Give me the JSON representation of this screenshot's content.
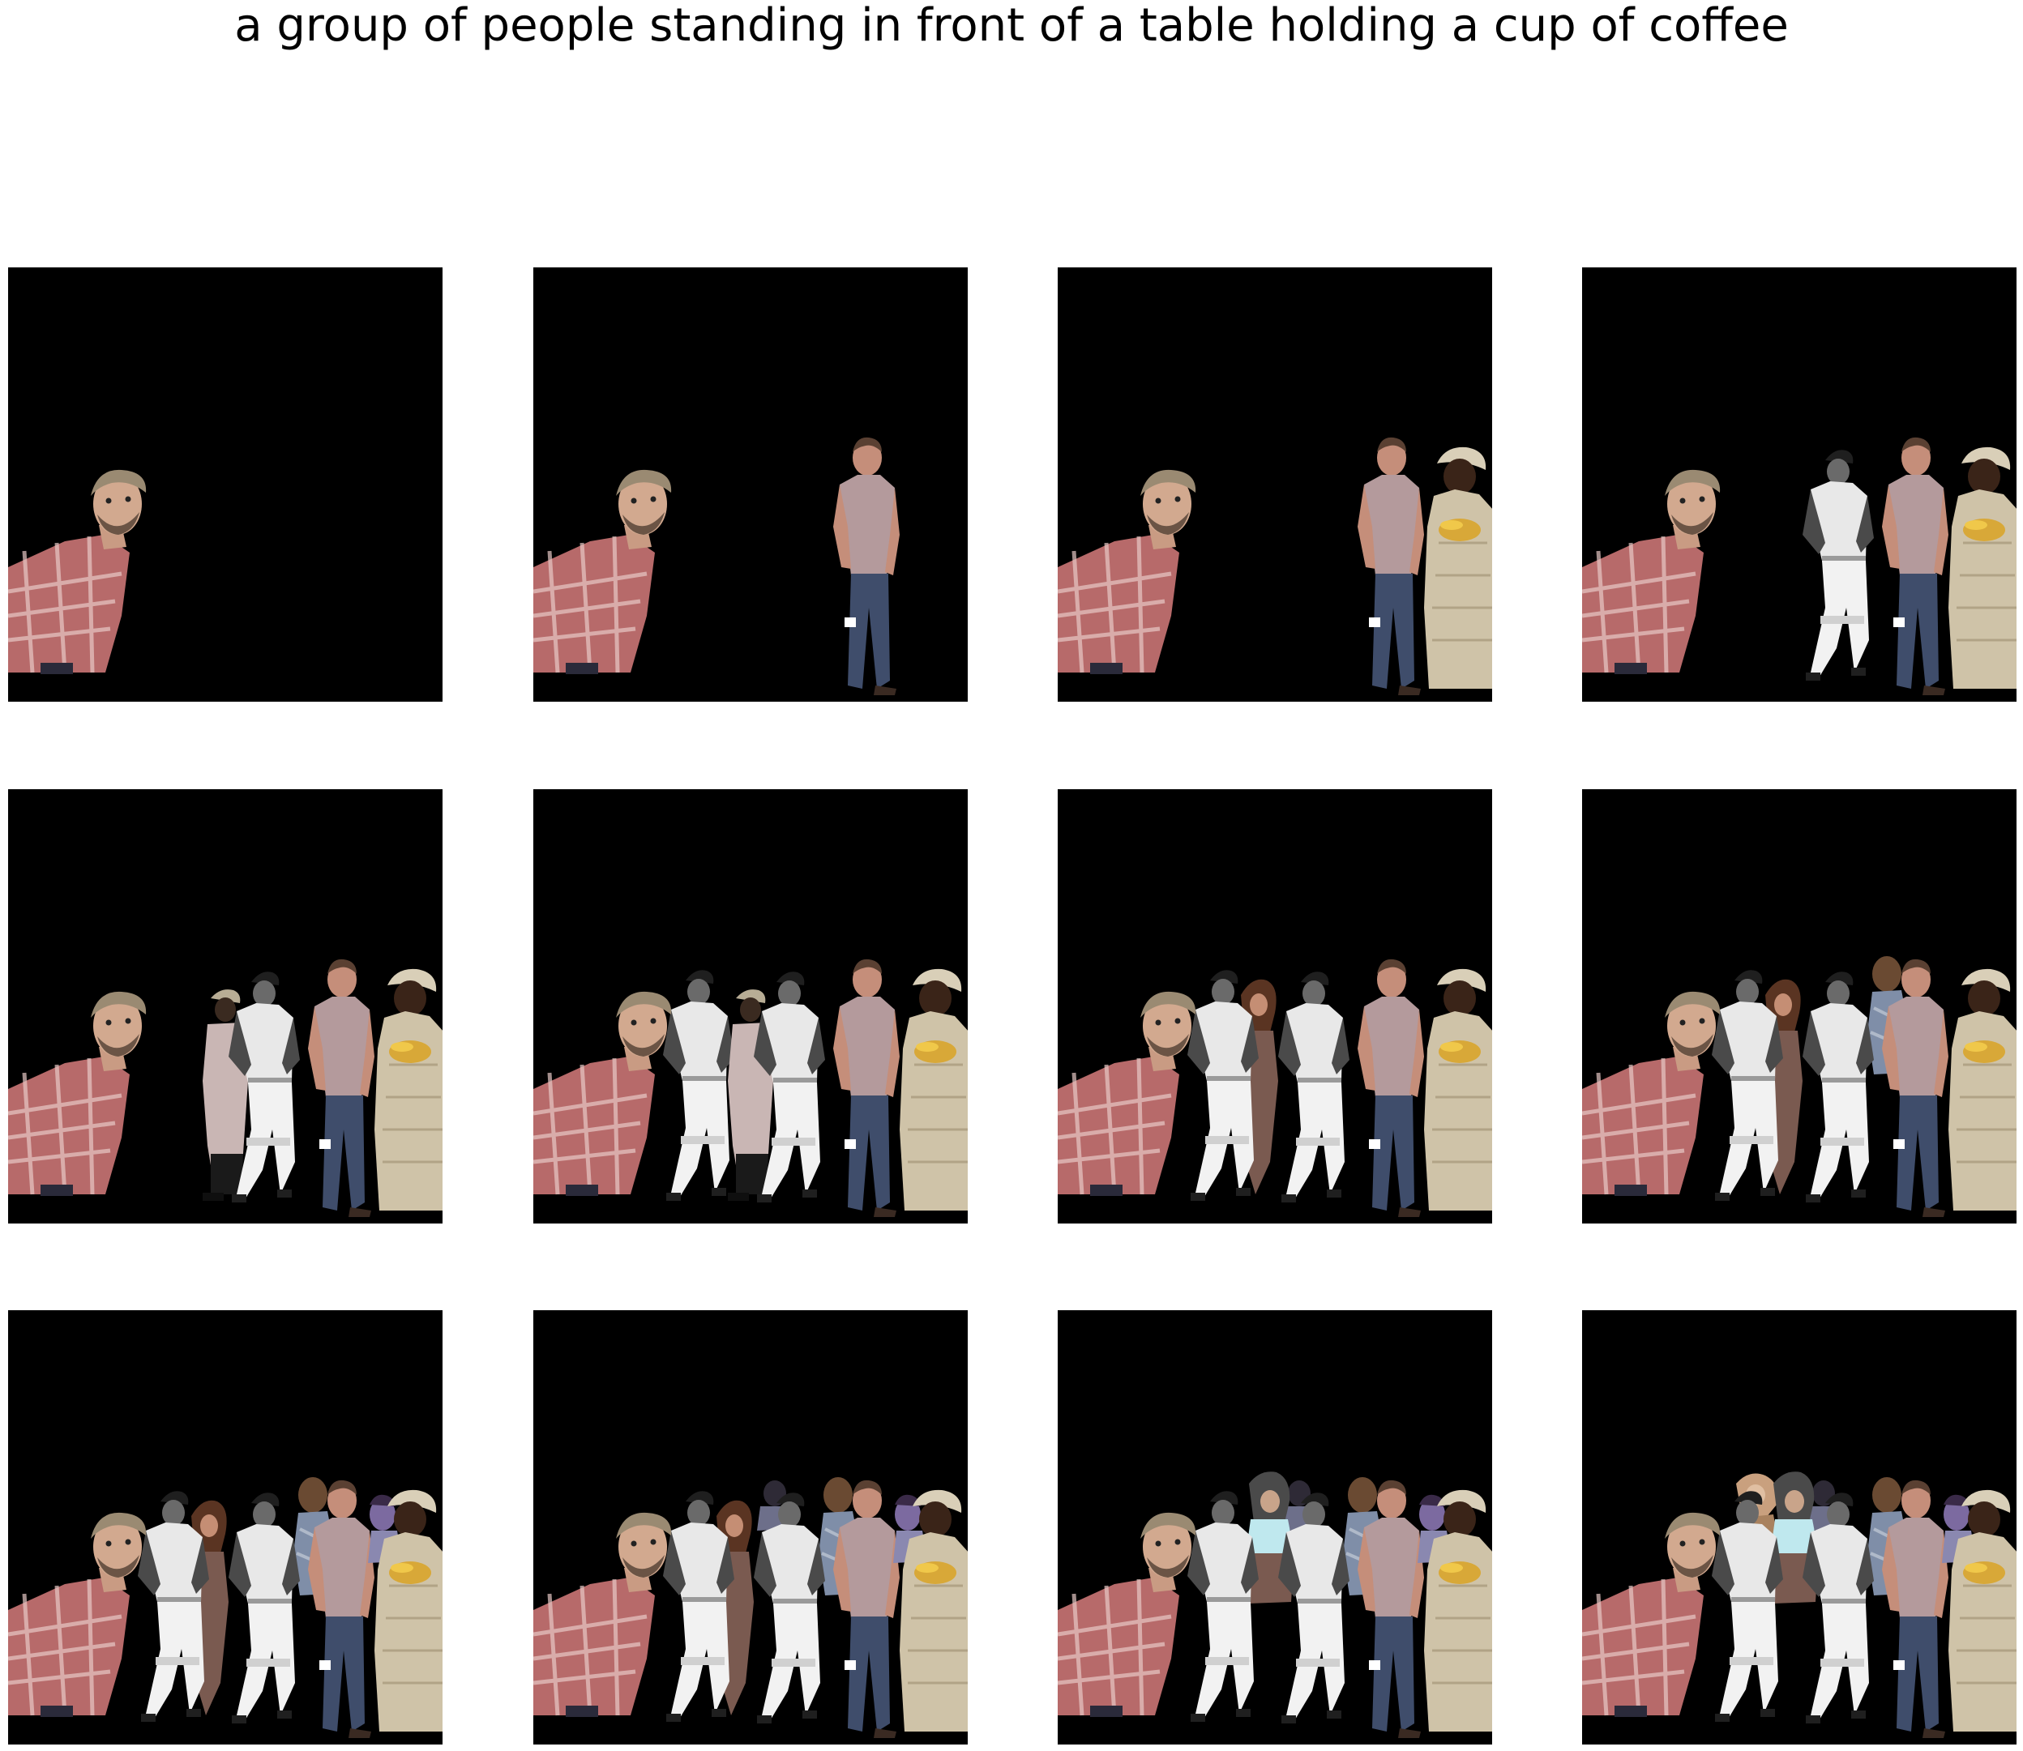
{
  "figure": {
    "title": "a group of people standing in front of a table holding a cup of coffee"
  },
  "grid": {
    "rows": 3,
    "cols": 4
  },
  "panels": [
    {
      "figures": [
        "leaning-man-plaid"
      ]
    },
    {
      "figures": [
        "leaning-man-plaid",
        "man-grey-tshirt"
      ]
    },
    {
      "figures": [
        "leaning-man-plaid",
        "man-grey-tshirt",
        "woman-patterned-dress"
      ]
    },
    {
      "figures": [
        "leaning-man-plaid",
        "baseball-player-1",
        "man-grey-tshirt",
        "woman-patterned-dress"
      ]
    },
    {
      "figures": [
        "leaning-man-plaid",
        "person-dark-coat",
        "baseball-player-1",
        "man-grey-tshirt",
        "woman-patterned-dress"
      ]
    },
    {
      "figures": [
        "leaning-man-plaid",
        "baseball-player-2",
        "person-dark-coat",
        "baseball-player-1",
        "man-grey-tshirt",
        "woman-patterned-dress"
      ]
    },
    {
      "figures": [
        "leaning-man-plaid",
        "baseball-player-2",
        "woman-long-hair",
        "baseball-player-1",
        "man-grey-tshirt",
        "woman-patterned-dress"
      ]
    },
    {
      "figures": [
        "leaning-man-plaid",
        "baseball-player-2",
        "woman-long-hair",
        "baseball-player-1",
        "man-back-turned",
        "man-grey-tshirt",
        "woman-patterned-dress"
      ]
    },
    {
      "figures": [
        "leaning-man-plaid",
        "baseball-player-2",
        "woman-long-hair",
        "baseball-player-1",
        "man-back-turned",
        "man-grey-tshirt",
        "man-purple-face",
        "woman-patterned-dress"
      ]
    },
    {
      "figures": [
        "leaning-man-plaid",
        "baseball-player-2",
        "woman-long-hair",
        "person-small-top",
        "baseball-player-1",
        "man-back-turned",
        "man-grey-tshirt",
        "man-purple-face",
        "woman-patterned-dress"
      ]
    },
    {
      "figures": [
        "leaning-man-plaid",
        "baseball-player-2",
        "woman-dark-hair-cyan",
        "person-small-top",
        "baseball-player-1",
        "man-back-turned",
        "man-grey-tshirt",
        "man-purple-face",
        "woman-patterned-dress"
      ]
    },
    {
      "figures": [
        "leaning-man-plaid",
        "baseball-player-2",
        "person-tan-top",
        "woman-dark-hair-cyan",
        "person-small-top",
        "baseball-player-1",
        "man-back-turned",
        "man-grey-tshirt",
        "man-purple-face",
        "woman-patterned-dress"
      ]
    }
  ]
}
